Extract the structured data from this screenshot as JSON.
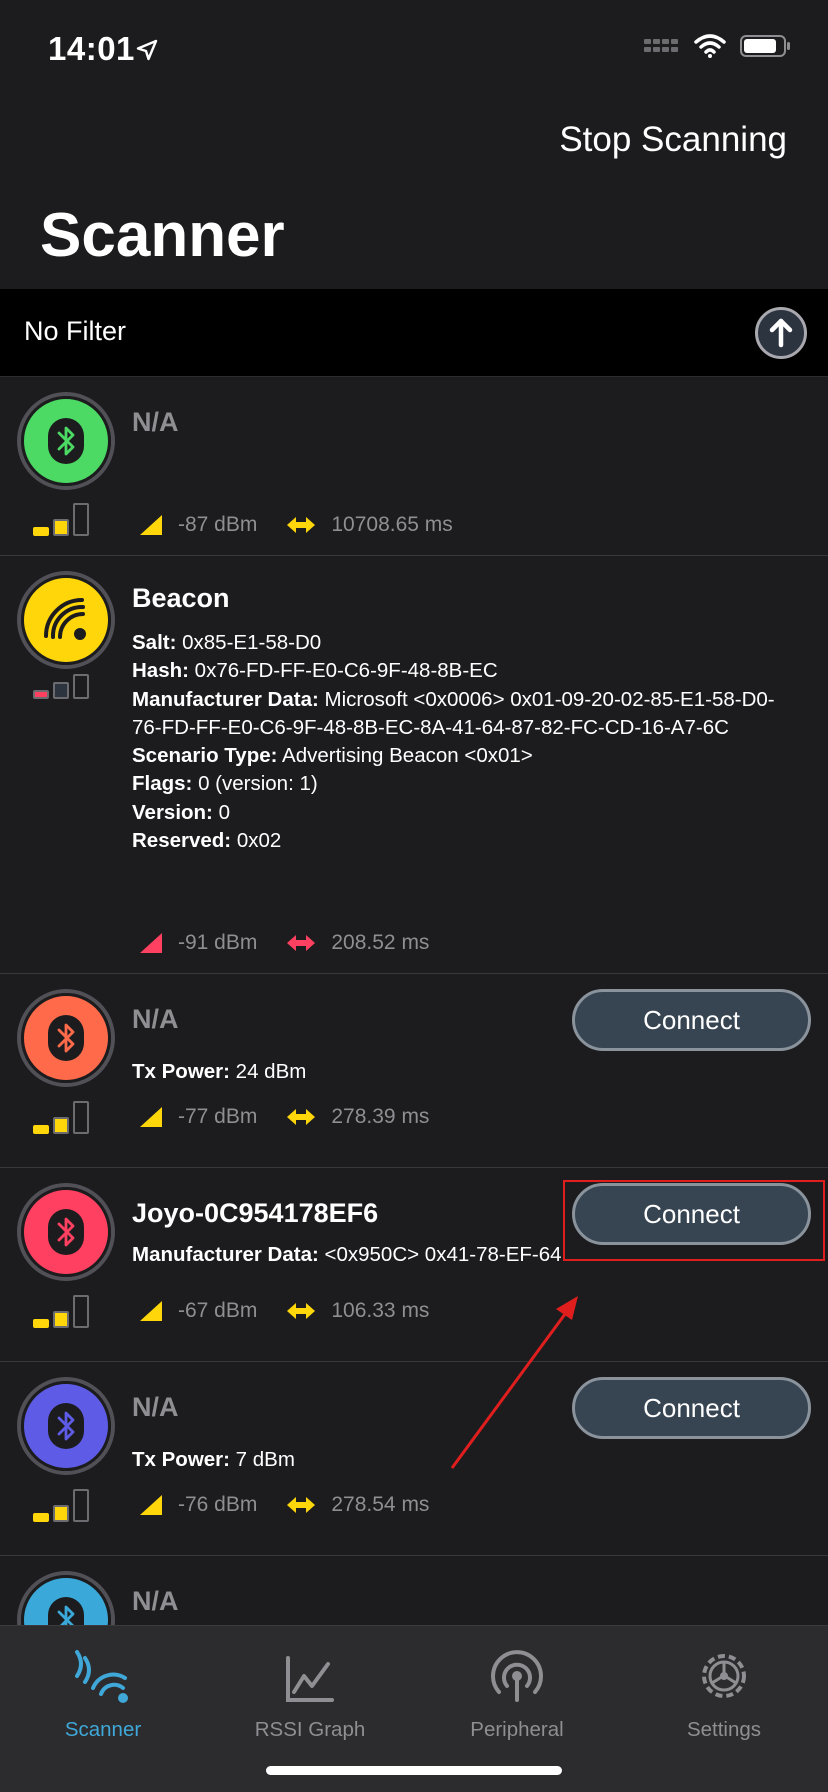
{
  "status": {
    "time": "14:01"
  },
  "nav": {
    "stop_label": "Stop Scanning",
    "title": "Scanner"
  },
  "filter": {
    "label": "No Filter"
  },
  "devices": [
    {
      "name": "N/A",
      "rssi": "-87 dBm",
      "interval": "10708.65 ms",
      "color": "#4cd964",
      "icon": "bluetooth-icon",
      "signal": 2
    },
    {
      "name": "Beacon",
      "color": "#ffd60a",
      "icon": "beacon-icon",
      "signal": 1,
      "details": [
        {
          "k": "Salt:",
          "v": " 0x85-E1-58-D0"
        },
        {
          "k": "Hash:",
          "v": " 0x76-FD-FF-E0-C6-9F-48-8B-EC"
        },
        {
          "k": "Manufacturer Data:",
          "v": " Microsoft <0x0006> 0x01-09-20-02-85-E1-58-D0-76-FD-FF-E0-C6-9F-48-8B-EC-8A-41-64-87-82-FC-CD-16-A7-6C"
        },
        {
          "k": "Scenario Type:",
          "v": " Advertising Beacon <0x01>"
        },
        {
          "k": "Flags:",
          "v": " 0 (version: 1)"
        },
        {
          "k": "Version:",
          "v": " 0"
        },
        {
          "k": "Reserved:",
          "v": " 0x02"
        }
      ],
      "rssi": "-91 dBm",
      "interval": "208.52 ms"
    },
    {
      "name": "N/A",
      "color": "#ff6b4a",
      "icon": "bluetooth-icon",
      "signal": 2,
      "details": [
        {
          "k": "Tx Power:",
          "v": " 24 dBm"
        }
      ],
      "rssi": "-77 dBm",
      "interval": "278.39 ms",
      "connect": "Connect"
    },
    {
      "name": "Joyo-0C954178EF6",
      "color": "#ff4060",
      "icon": "bluetooth-icon",
      "signal": 2,
      "details": [
        {
          "k": "Manufacturer Data:",
          "v": " <0x950C> 0x41-78-EF-64"
        }
      ],
      "rssi": "-67 dBm",
      "interval": "106.33 ms",
      "connect": "Connect"
    },
    {
      "name": "N/A",
      "color": "#5e5ce6",
      "icon": "bluetooth-icon",
      "signal": 2,
      "details": [
        {
          "k": "Tx Power:",
          "v": " 7 dBm"
        }
      ],
      "rssi": "-76 dBm",
      "interval": "278.54 ms",
      "connect": "Connect"
    },
    {
      "name": "N/A",
      "color": "#3aa8d8",
      "icon": "bluetooth-icon",
      "signal": 2
    }
  ],
  "tabs": [
    {
      "label": "Scanner",
      "icon": "scanner-icon",
      "active": true
    },
    {
      "label": "RSSI Graph",
      "icon": "graph-icon"
    },
    {
      "label": "Peripheral",
      "icon": "peripheral-icon"
    },
    {
      "label": "Settings",
      "icon": "settings-icon"
    }
  ]
}
